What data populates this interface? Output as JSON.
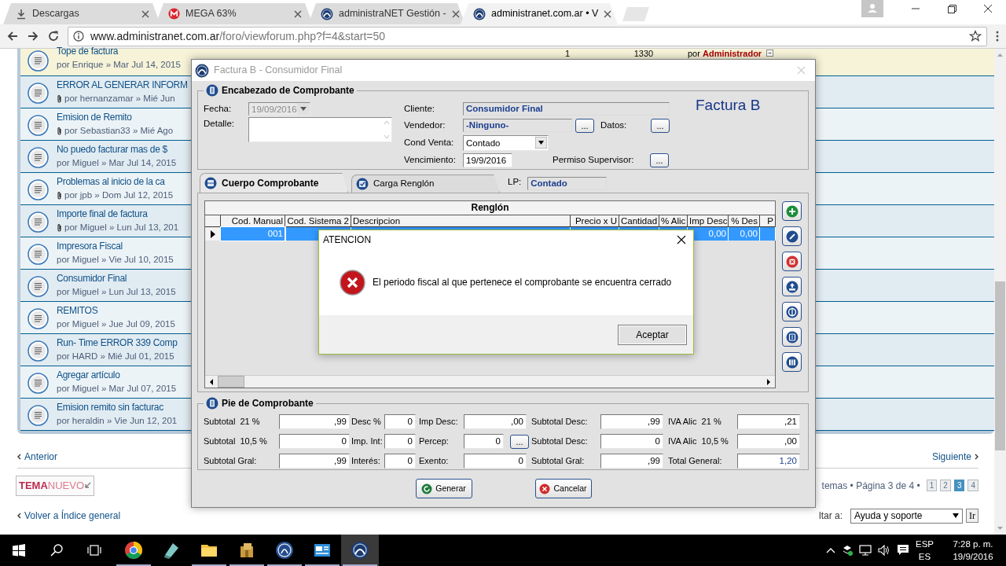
{
  "browser": {
    "tabs": [
      {
        "kind": "download",
        "title": "Descargas",
        "selected": false
      },
      {
        "kind": "mega",
        "title": "MEGA 63%",
        "selected": false
      },
      {
        "kind": "site",
        "title": "administraNET Gestión -",
        "selected": false
      },
      {
        "kind": "site",
        "title": "administranet.com.ar • V",
        "selected": true
      }
    ],
    "address": {
      "host": "www.administranet.com.ar",
      "path": "/foro/viewforum.php?f=4&start=50"
    }
  },
  "forum": {
    "topics": [
      {
        "title": "Tope de factura",
        "meta": "por Enrique » Mar Jul 14, 2015",
        "attachment": false,
        "highlighted": true,
        "replies": "1",
        "views": "1330",
        "last_post": "por **Administrador**"
      },
      {
        "title": "ERROR AL GENERAR INFORM",
        "meta": "por hernanzamar » Mié Jun",
        "attachment": true,
        "highlighted": false
      },
      {
        "title": "Emision de Remito",
        "meta": "por Sebastian33 » Mié Ago",
        "attachment": true,
        "highlighted": false
      },
      {
        "title": "No puedo facturar mas de $",
        "meta": "por Miguel » Mar Jul 14, 2015",
        "attachment": false,
        "highlighted": false
      },
      {
        "title": "Problemas al inicio de la ca",
        "meta": "por jpb » Dom Jul 12, 2015",
        "attachment": true,
        "highlighted": false
      },
      {
        "title": "Importe final de factura",
        "meta": "por Miguel » Lun Jul 13, 201",
        "attachment": true,
        "highlighted": false
      },
      {
        "title": "Impresora Fiscal",
        "meta": "por Miguel » Vie Jul 10, 2015",
        "attachment": false,
        "highlighted": false
      },
      {
        "title": "Consumidor Final",
        "meta": "por Miguel » Lun Jul 13, 2015",
        "attachment": false,
        "highlighted": false
      },
      {
        "title": "REMITOS",
        "meta": "por Miguel » Jue Jul 09, 2015",
        "attachment": false,
        "highlighted": false
      },
      {
        "title": "Run- Time ERROR 339 Comp",
        "meta": "por HARD » Mié Jul 01, 2015",
        "attachment": false,
        "highlighted": false
      },
      {
        "title": "Agregar artículo",
        "meta": "por Miguel » Mar Jul 07, 2015",
        "attachment": false,
        "highlighted": false
      },
      {
        "title": "Emision remito sin facturac",
        "meta": "por heraldin » Vie Jun 12, 201",
        "attachment": false,
        "highlighted": false
      }
    ],
    "prev": "Anterior",
    "next": "Siguiente",
    "new_topic_strong": "TEMA",
    "new_topic_light": "NUEVO",
    "summary": "temas • Página 3 de 4 •",
    "pages": [
      {
        "label": "1",
        "selected": false
      },
      {
        "label": "2",
        "selected": false
      },
      {
        "label": "3",
        "selected": true
      },
      {
        "label": "4",
        "selected": false
      }
    ],
    "back": "Volver a Índice general",
    "jump_label": "ltar a:",
    "jump_value": "Ayuda y soporte",
    "jump_button": "Ir"
  },
  "dialog": {
    "title": "Factura B - Consumidor Final",
    "header": {
      "legend": "Encabezado de Comprobante",
      "heading": "Factura B",
      "fecha": {
        "label": "Fecha:",
        "value": "19/09/2016",
        "disabled": true
      },
      "detalle": {
        "label": "Detalle:"
      },
      "cliente": {
        "label": "Cliente:",
        "value": "Consumidor Final"
      },
      "vendedor": {
        "label": "Vendedor:",
        "value": "-Ninguno-",
        "button": "..."
      },
      "datos": {
        "label": "Datos:",
        "button": "..."
      },
      "cond_venta": {
        "label": "Cond Venta:",
        "value": "Contado"
      },
      "vencimiento": {
        "label": "Vencimiento:",
        "value": "19/9/2016"
      },
      "permiso": {
        "label": "Permiso Supervisor:",
        "button": "..."
      }
    },
    "tabs": [
      {
        "label": "Cuerpo Comprobante",
        "selected": true
      },
      {
        "label": "Carga Renglón",
        "selected": false
      }
    ],
    "lp": {
      "label": "LP:",
      "value": "Contado"
    },
    "grid": {
      "title": "Renglón",
      "columns": [
        "Cod. Manual",
        "Cod. Sistema 2",
        "Descripcion",
        "Precio x U",
        "Cantidad",
        "% Alic",
        "Imp Desc",
        "% Des",
        "P"
      ],
      "rows": [
        {
          "selected": true,
          "cells": [
            "001",
            null,
            null,
            null,
            null,
            null,
            "0,00",
            "0,00",
            null
          ]
        }
      ]
    },
    "footer": {
      "legend": "Pie de Comprobante",
      "rows": [
        [
          {
            "label": "Subtotal  21 %",
            "value": ",99"
          },
          {
            "label": "Desc %",
            "value": "0"
          },
          {
            "label": "Imp Desc:",
            "value": ",00"
          },
          {
            "label": "Subtotal Desc:",
            "value": ",99"
          },
          {
            "label": "IVA Alic  21 %",
            "value": ",21"
          }
        ],
        [
          {
            "label": "Subtotal  10,5 %",
            "value": "0"
          },
          {
            "label": "Imp. Int:",
            "value": "0"
          },
          {
            "label": "Percep:",
            "value": "0",
            "button": "..."
          },
          {
            "label": "Subtotal Desc:",
            "value": "0"
          },
          {
            "label": "IVA Alic  10,5 %",
            "value": ",00"
          }
        ],
        [
          {
            "label": "Subtotal Gral:",
            "value": ",99"
          },
          {
            "label": "Interés:",
            "value": "0"
          },
          {
            "label": "Exento:",
            "value": "0"
          },
          {
            "label": "Subtotal Gral:",
            "value": ",99"
          },
          {
            "label": "Total General:",
            "value": "1,20",
            "highlight": true
          }
        ]
      ]
    },
    "buttons": [
      {
        "kind": "ok",
        "label": "Generar"
      },
      {
        "kind": "cancel",
        "label": "Cancelar"
      }
    ]
  },
  "message": {
    "title": "ATENCION",
    "text": "El periodo fiscal al que pertenece el comprobante se encuentra cerrado",
    "button": "Aceptar"
  },
  "taskbar": {
    "apps": [
      {
        "kind": "chrome",
        "running": true,
        "active": false
      },
      {
        "kind": "tool",
        "running": false,
        "active": false
      },
      {
        "kind": "folder",
        "running": true,
        "active": false
      },
      {
        "kind": "package",
        "running": true,
        "active": false
      },
      {
        "kind": "globe",
        "running": true,
        "active": false
      },
      {
        "kind": "card",
        "running": true,
        "active": false
      },
      {
        "kind": "logo",
        "running": true,
        "active": true
      }
    ],
    "lang": "ESP",
    "layout": "ES",
    "time": "7:28 p. m.",
    "date": "19/9/2016"
  }
}
